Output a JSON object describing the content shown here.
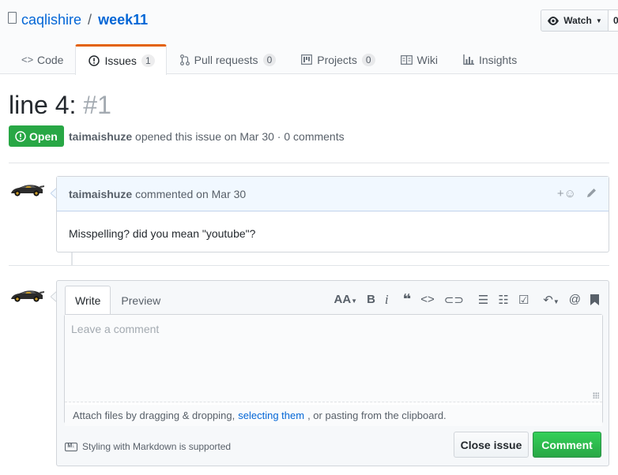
{
  "repo": {
    "owner": "caqlishire",
    "separator": "/",
    "name": "week11",
    "watch_label": "Watch",
    "watch_count": "0"
  },
  "nav": {
    "tabs": [
      {
        "icon": "code-icon",
        "label": "Code",
        "count": null
      },
      {
        "icon": "issue-opened-icon",
        "label": "Issues",
        "count": "1"
      },
      {
        "icon": "git-pull-request-icon",
        "label": "Pull requests",
        "count": "0"
      },
      {
        "icon": "project-icon",
        "label": "Projects",
        "count": "0"
      },
      {
        "icon": "book-icon",
        "label": "Wiki",
        "count": null
      },
      {
        "icon": "graph-icon",
        "label": "Insights",
        "count": null
      }
    ]
  },
  "issue": {
    "title": "line 4:",
    "number": "#1",
    "state": "Open",
    "author": "taimaishuze",
    "meta_text": "opened this issue on Mar 30 · 0 comments"
  },
  "comment": {
    "author": "taimaishuze",
    "action_text": "commented on Mar 30",
    "body": "Misspelling? did you mean \"youtube\"?"
  },
  "form": {
    "tab_write": "Write",
    "tab_preview": "Preview",
    "placeholder": "Leave a comment",
    "drop_prefix": "Attach files by dragging & dropping,",
    "drop_link": "selecting them",
    "drop_suffix": ", or pasting from the clipboard.",
    "markdown_note": "Styling with Markdown is supported",
    "close_label": "Close issue",
    "comment_label": "Comment"
  },
  "colors": {
    "link": "#0366d6",
    "open_green": "#28a745",
    "tab_accent": "#e36209",
    "comment_header": "#f1f8ff"
  }
}
